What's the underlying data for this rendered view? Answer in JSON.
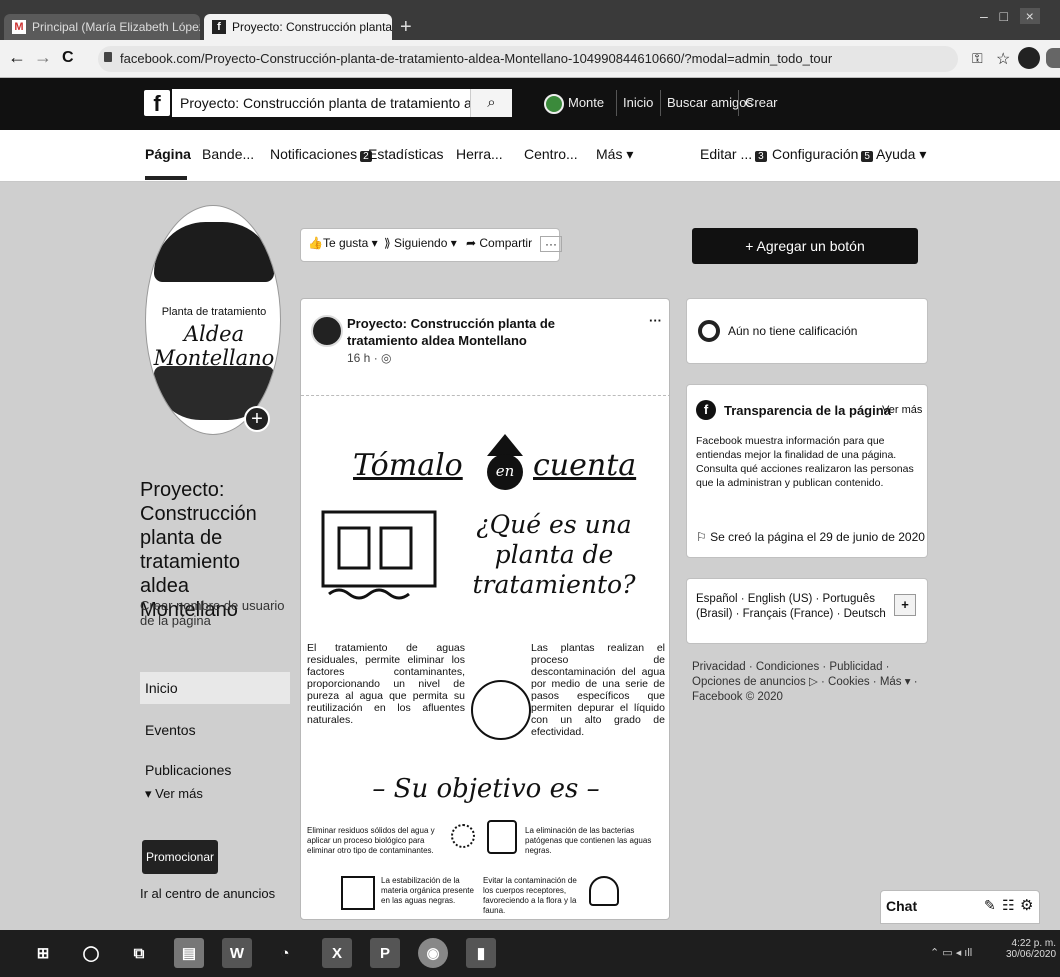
{
  "browser": {
    "tabs": [
      {
        "title": "Principal (María Elizabeth López)",
        "icon": "gmail-icon"
      },
      {
        "title": "Proyecto: Construcción planta de",
        "icon": "facebook-icon"
      }
    ],
    "new_tab": "+",
    "window_controls": {
      "minimize": "–",
      "maximize": "□",
      "close": "×"
    },
    "nav": {
      "back": "←",
      "forward": "→",
      "reload": "C"
    },
    "url": "facebook.com/Proyecto-Construcción-planta-de-tratamiento-aldea-Montellano-104990844610660/?modal=admin_todo_tour"
  },
  "fb_header": {
    "logo": "f",
    "search_value": "Proyecto: Construcción planta de tratamiento aldea Montell...",
    "user": "Monte",
    "links": [
      "Inicio",
      "Buscar amigos",
      "Crear"
    ]
  },
  "page_nav": {
    "tabs": [
      "Página",
      "Bande...",
      "Notificaciones",
      "Estadísticas",
      "Herra...",
      "Centro...",
      "Más ▾"
    ],
    "notifications_badge": "2",
    "right": [
      "Editar ...",
      "Configuración",
      "Ayuda ▾"
    ],
    "editar_badge": "3",
    "config_badge": "5"
  },
  "left": {
    "avatar_line1": "Planta de tratamiento",
    "avatar_line2": "Aldea Montellano",
    "page_name": "Proyecto: Construcción planta de tratamiento aldea Montellano",
    "create_username": "Crear nombre de usuario de la página",
    "nav": [
      "Inicio",
      "Eventos",
      "Publicaciones"
    ],
    "see_more": "▾ Ver más",
    "promote": "Promocionar",
    "ads_center": "Ir al centro de anuncios"
  },
  "actions": {
    "like": "Te gusta ▾",
    "follow": "Siguiendo ▾",
    "share": "Compartir",
    "more": "···"
  },
  "post": {
    "author": "Proyecto: Construcción planta de tratamiento aldea Montellano",
    "time": "16 h · ",
    "menu": "···",
    "heading_a": "Tómalo",
    "heading_en": "en",
    "heading_b": "cuenta",
    "question": "¿Qué es una planta de tratamiento?",
    "para_left": "El tratamiento de aguas residuales, permite eliminar los factores contaminantes, proporcionando un nivel de pureza al agua que permita su reutilización en los afluentes naturales.",
    "para_right": "Las plantas realizan el proceso de descontaminación del agua por medio de una serie de pasos específicos que permiten depurar el líquido con un alto grado de efectividad.",
    "objective": "– Su objetivo es –",
    "obj1": "Eliminar residuos sólidos del agua y aplicar un proceso biológico para eliminar otro tipo de contaminantes.",
    "obj2": "La eliminación de las bacterias patógenas que contienen las aguas negras.",
    "obj3": "La estabilización de la materia orgánica presente en las aguas negras.",
    "obj4": "Evitar la contaminación de los cuerpos receptores, favoreciendo a la flora y la fauna."
  },
  "right": {
    "add_button": "+ Agregar un botón",
    "rating": "Aún no tiene calificación",
    "transparency_title": "Transparencia de la página",
    "see_more": "Ver más",
    "transparency_text": "Facebook muestra información para que entiendas mejor la finalidad de una página. Consulta qué acciones realizaron las personas que la administran y publican contenido.",
    "created": "Se creó la página el 29 de junio de 2020",
    "languages": "Español · English (US) · Português (Brasil) · Français (France) · Deutsch",
    "lang_add": "+",
    "footer": "Privacidad · Condiciones · Publicidad · Opciones de anuncios ▷ · Cookies · Más ▾ · Facebook © 2020"
  },
  "chat": {
    "label": "Chat"
  },
  "taskbar": {
    "time": "4:22 p. m.",
    "date": "30/06/2020"
  }
}
